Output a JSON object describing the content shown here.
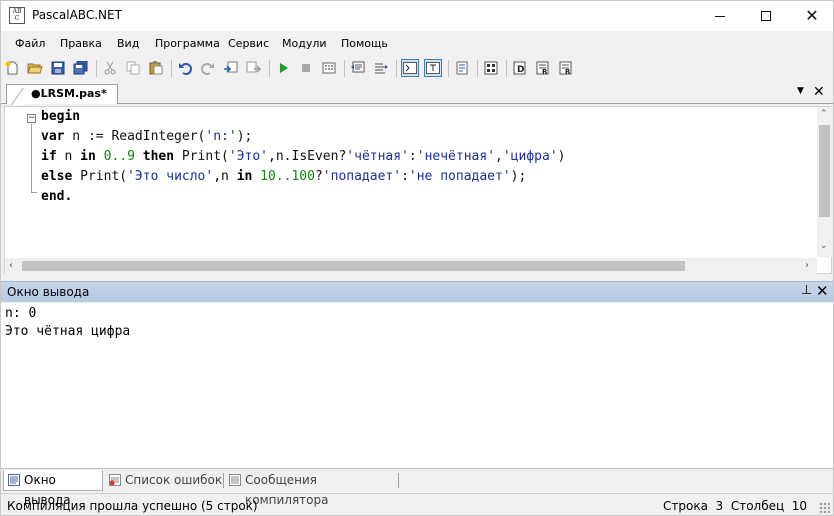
{
  "window": {
    "title": "PascalABC.NET",
    "icon_text": "AB C"
  },
  "menu": [
    "Файл",
    "Правка",
    "Вид",
    "Программа",
    "Сервис",
    "Модули",
    "Помощь"
  ],
  "toolbar_icons": [
    "new-file-icon",
    "open-icon",
    "save-icon",
    "save-all-icon",
    "cut-icon",
    "copy-icon",
    "paste-icon",
    "undo-icon",
    "redo-icon",
    "find-icon",
    "replace-icon",
    "run-icon",
    "stop-icon",
    "compile-icon",
    "comment-icon",
    "uncomment-icon",
    "console-output-icon",
    "text-output-icon",
    "debug-step-icon",
    "debug-watch-icon",
    "debug-into-icon",
    "debug-over-icon",
    "debug-out-icon"
  ],
  "editor": {
    "tab_label": "●LRSM.pas*",
    "lines": [
      {
        "t": [
          [
            "kw",
            "begin"
          ]
        ]
      },
      {
        "t": [
          [
            "kw",
            "var"
          ],
          [
            "plain",
            " n := ReadInteger("
          ],
          [
            "str",
            "'n:'"
          ],
          [
            "plain",
            ");"
          ]
        ]
      },
      {
        "t": [
          [
            "kw",
            "if"
          ],
          [
            "plain",
            " n "
          ],
          [
            "kw",
            "in"
          ],
          [
            "plain",
            " "
          ],
          [
            "num",
            "0..9"
          ],
          [
            "plain",
            " "
          ],
          [
            "kw",
            "then"
          ],
          [
            "plain",
            " Print("
          ],
          [
            "str",
            "'Это'"
          ],
          [
            "plain",
            ",n.IsEven?"
          ],
          [
            "str",
            "'чётная'"
          ],
          [
            "plain",
            ":"
          ],
          [
            "str",
            "'нечётная'"
          ],
          [
            "plain",
            ","
          ],
          [
            "str",
            "'цифра'"
          ],
          [
            "plain",
            ")"
          ]
        ]
      },
      {
        "t": [
          [
            "kw",
            "else"
          ],
          [
            "plain",
            " Print("
          ],
          [
            "str",
            "'Это число'"
          ],
          [
            "plain",
            ",n "
          ],
          [
            "kw",
            "in"
          ],
          [
            "plain",
            " "
          ],
          [
            "num",
            "10..100"
          ],
          [
            "plain",
            "?"
          ],
          [
            "str",
            "'попадает'"
          ],
          [
            "plain",
            ":"
          ],
          [
            "str",
            "'не попадает'"
          ],
          [
            "plain",
            ");"
          ]
        ]
      },
      {
        "t": [
          [
            "kw",
            "end."
          ]
        ]
      }
    ]
  },
  "output": {
    "title": "Окно вывода",
    "lines": [
      "n: 0",
      "Это чётная цифра"
    ]
  },
  "bottom_tabs": [
    "Окно вывода",
    "Список ошибок",
    "Сообщения компилятора"
  ],
  "status": {
    "message": "Компиляция прошла успешно (5 строк)",
    "position": "Строка  3  Столбец  10"
  },
  "colors": {
    "keyword": "#000000",
    "string": "#1e2d9e",
    "number": "#0a8a0a",
    "output_header": "#bfd1e8"
  }
}
